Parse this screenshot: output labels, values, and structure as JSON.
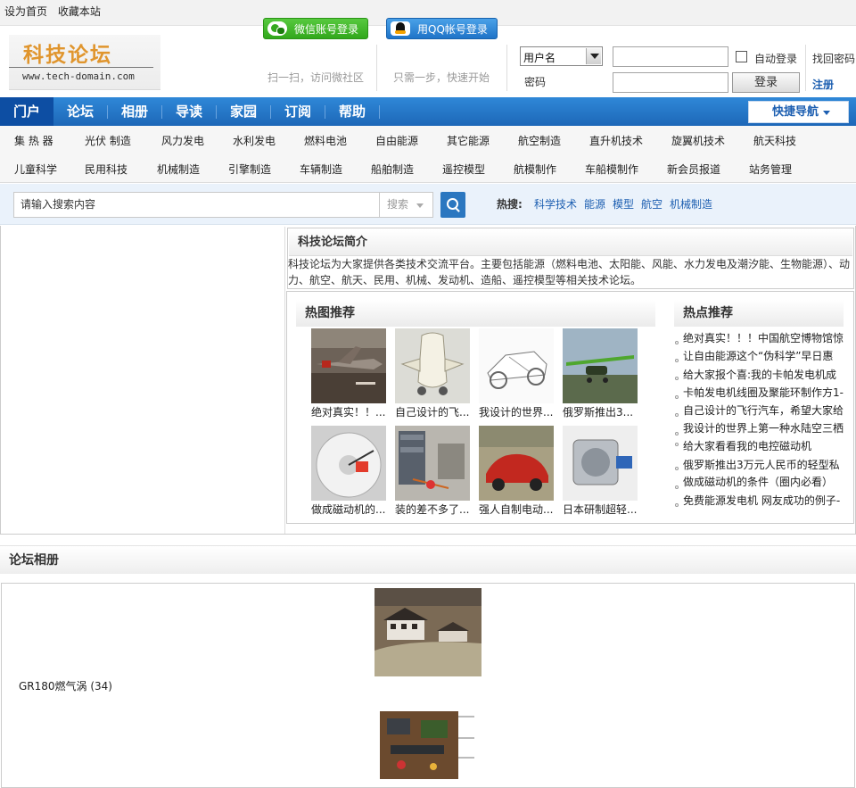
{
  "topbar": {
    "set_home": "设为首页",
    "bookmark": "收藏本站"
  },
  "logo": {
    "title": "科技论坛",
    "url": "www.tech-domain.com"
  },
  "social": {
    "wechat_label": "微信账号登录",
    "wechat_hint": "扫一扫，访问微社区",
    "qq_label": "用QQ帐号登录",
    "qq_hint": "只需一步，快速开始"
  },
  "login": {
    "username_option": "用户名",
    "password_label": "密码",
    "auto_login": "自动登录",
    "submit": "登录",
    "forgot": "找回密码",
    "register": "注册"
  },
  "nav": {
    "items": [
      "门户",
      "论坛",
      "相册",
      "导读",
      "家园",
      "订阅",
      "帮助"
    ],
    "quick": "快捷导航"
  },
  "subnav": {
    "row1": [
      "集 热 器",
      "光伏 制造",
      "风力发电",
      "水利发电",
      "燃料电池",
      "自由能源",
      "其它能源",
      "航空制造",
      "直升机技术",
      "旋翼机技术",
      "航天科技"
    ],
    "row2": [
      "儿童科学",
      "民用科技",
      "机械制造",
      "引擎制造",
      "车辆制造",
      "船舶制造",
      "遥控模型",
      "航模制作",
      "车船模制作",
      "新会员报道",
      "站务管理"
    ]
  },
  "search": {
    "placeholder": "请输入搜索内容",
    "type": "搜索",
    "hot_label": "热搜:",
    "hot_terms": [
      "科学技术",
      "能源",
      "模型",
      "航空",
      "机械制造"
    ]
  },
  "intro": {
    "title": "科技论坛简介",
    "text": "科技论坛为大家提供各类技术交流平台。主要包括能源（燃料电池、太阳能、风能、水力发电及潮汐能、生物能源）、动力、航空、航天、民用、机械、发动机、造船、遥控模型等相关技术论坛。"
  },
  "hot_pics": {
    "title": "热图推荐",
    "items": [
      {
        "caption": "绝对真实！！..."
      },
      {
        "caption": "自己设计的飞..."
      },
      {
        "caption": "我设计的世界..."
      },
      {
        "caption": "俄罗斯推出3..."
      },
      {
        "caption": "做成磁动机的..."
      },
      {
        "caption": "装的差不多了..."
      },
      {
        "caption": "强人自制电动..."
      },
      {
        "caption": "日本研制超轻..."
      }
    ]
  },
  "hot_topics": {
    "title": "热点推荐",
    "items": [
      "绝对真实！！！中国航空博物馆惊",
      "让自由能源这个“伪科学”早日惠",
      "给大家报个喜:我的卡帕发电机成",
      "卡帕发电机线圈及聚能环制作方1-",
      "自己设计的飞行汽车，希望大家给",
      "我设计的世界上第一种水陆空三栖",
      "给大家看看我的电控磁动机",
      "俄罗斯推出3万元人民币的轻型私",
      "做成磁动机的条件（圈内必看）",
      "免费能源发电机 网友成功的例子-"
    ]
  },
  "album": {
    "section_title": "论坛相册",
    "name": "GR180燃气涡 (34)"
  },
  "colors": {
    "nav_blue": "#1d67b8",
    "nav_active": "#0d4ea3",
    "logo_orange": "#e0952d",
    "link_blue": "#1d5fb1"
  }
}
